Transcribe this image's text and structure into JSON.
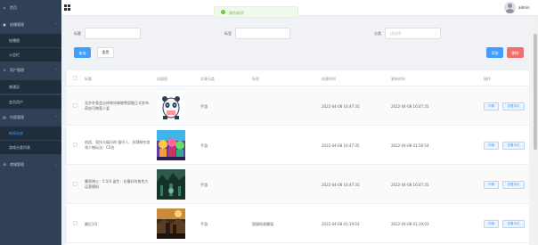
{
  "sidebar": {
    "items": [
      {
        "label": "首页",
        "icon": "home-icon",
        "type": "top",
        "expanded": false
      },
      {
        "label": "轮播管理",
        "icon": "image-icon",
        "type": "group",
        "expanded": true
      },
      {
        "label": "轮播图",
        "type": "sub"
      },
      {
        "label": "公告栏",
        "type": "sub"
      },
      {
        "label": "用户管理",
        "icon": "user-icon",
        "type": "group",
        "expanded": true
      },
      {
        "label": "普通员",
        "type": "sub"
      },
      {
        "label": "会员用户",
        "type": "sub"
      },
      {
        "label": "内容管理",
        "icon": "document-icon",
        "type": "group",
        "expanded": true
      },
      {
        "label": "新闻动态",
        "type": "sub",
        "active": true
      },
      {
        "label": "游戏分类列表",
        "type": "sub"
      },
      {
        "label": "商城管理",
        "icon": "shop-icon",
        "type": "group",
        "expanded": false
      }
    ]
  },
  "header": {
    "user_name": "admin"
  },
  "toast": {
    "message": "操作成功!",
    "color": "#67c23a"
  },
  "search": {
    "title_label": "标题",
    "title_value": "",
    "tag_label": "标签",
    "tag_value": "",
    "category_label": "分类",
    "category_placeholder": "请选择",
    "query_button": "查询",
    "reset_button": "重置",
    "add_button": "添加",
    "delete_button": "删除"
  },
  "table": {
    "columns": [
      "标题",
      "封面图",
      "文章分类",
      "标签",
      "创建时间",
      "更新时间",
      "操作"
    ],
    "edit_label": "详情",
    "view_label": "查看评论",
    "rows": [
      {
        "title": "北京冬奥会吉祥物冰墩墩雪容融正式发布 萌态可掬惹人爱",
        "category": "手游",
        "tag": "",
        "created": "2022-04-08 16:47:35",
        "updated": "2022-04-08 16:47:35",
        "thumb": "panda"
      },
      {
        "title": "创造、竞技与娱乐的 蛋仔人、仿洞制作游戏人物玩法：CS名",
        "category": "手游",
        "tag": "",
        "created": "2022-04-08 16:47:35",
        "updated": "2022-04-08 01:56:54",
        "thumb": "colorful"
      },
      {
        "title": "暴雨博士：5.5/4 诞生：在最好的角色大运营模拟",
        "category": "手游",
        "tag": "",
        "created": "2022-04-08 16:47:35",
        "updated": "2022-04-08 16:47:35",
        "thumb": "forest"
      },
      {
        "title": "最后1号",
        "category": "手游",
        "tag": "国服地表最强",
        "created": "2022-04-08 01:19:03",
        "updated": "2022-04-08 01:19:03",
        "thumb": "battle"
      }
    ]
  },
  "colors": {
    "sidebar_bg": "#304156",
    "primary": "#409eff",
    "danger": "#f56c6c",
    "success": "#67c23a"
  }
}
